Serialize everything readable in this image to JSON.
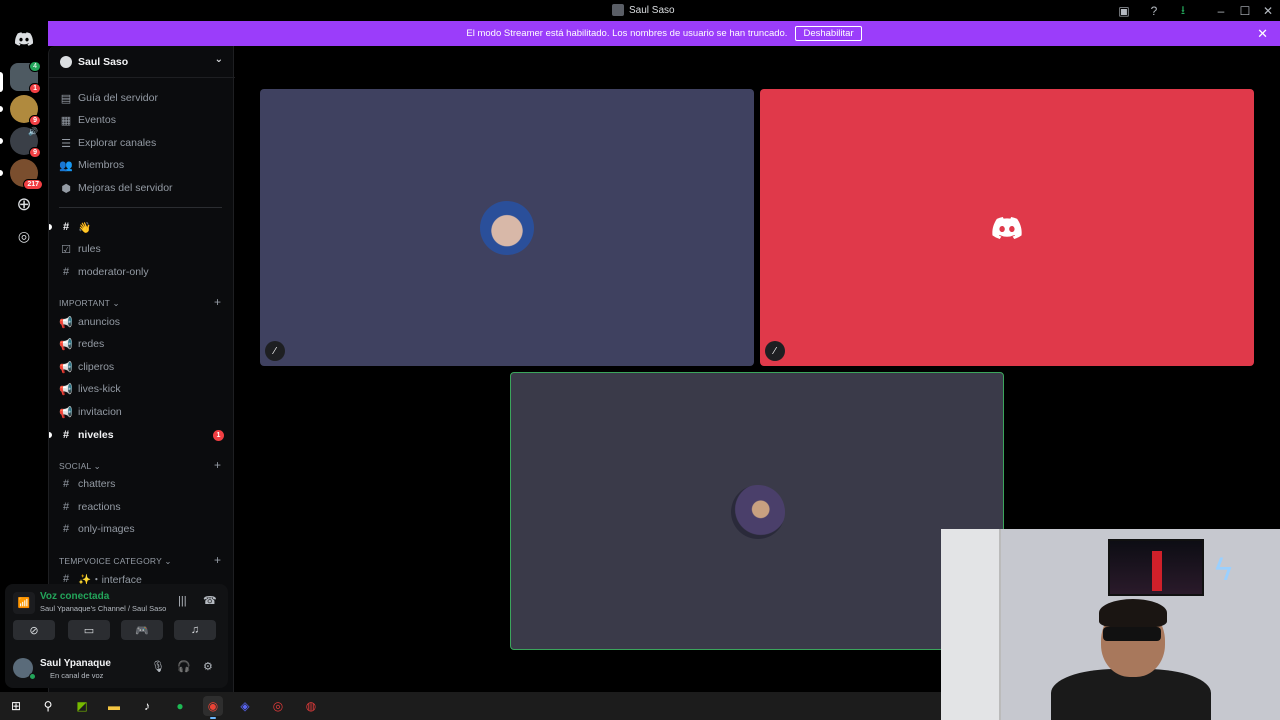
{
  "window": {
    "title": "Saul Saso"
  },
  "banner": {
    "text": "El modo Streamer está habilitado. Los nombres de usuario se han truncado.",
    "button": "Deshabilitar"
  },
  "rail": {
    "servers": [
      {
        "name": "server-1",
        "badge": "1",
        "badge2": "4"
      },
      {
        "name": "server-2",
        "badge": "9"
      },
      {
        "name": "server-3",
        "badge": "9"
      },
      {
        "name": "server-4",
        "badge": "217"
      }
    ]
  },
  "server": {
    "name": "Saul Saso"
  },
  "nav": [
    {
      "label": "Guía del servidor",
      "icon": "guide-icon"
    },
    {
      "label": "Eventos",
      "icon": "calendar-icon"
    },
    {
      "label": "Explorar canales",
      "icon": "channels-icon"
    },
    {
      "label": "Miembros",
      "icon": "members-icon"
    },
    {
      "label": "Mejoras del servidor",
      "icon": "boost-icon"
    }
  ],
  "channels_top": [
    {
      "label": "👋",
      "icon": "hash"
    },
    {
      "label": "rules",
      "icon": "rules"
    },
    {
      "label": "moderator-only",
      "icon": "hash"
    }
  ],
  "categories": {
    "important": "IMPORTANT",
    "social": "SOCIAL",
    "tempvoice": "TEMPVOICE CATEGORY"
  },
  "channels_important": [
    {
      "label": "anuncios",
      "icon": "megaphone"
    },
    {
      "label": "redes",
      "icon": "megaphone"
    },
    {
      "label": "cliperos",
      "icon": "megaphone"
    },
    {
      "label": "lives-kick",
      "icon": "megaphone"
    },
    {
      "label": "invitacion",
      "icon": "megaphone"
    },
    {
      "label": "niveles",
      "icon": "hash",
      "badge": "1"
    }
  ],
  "channels_social": [
    {
      "label": "chatters",
      "icon": "hash"
    },
    {
      "label": "reactions",
      "icon": "hash"
    },
    {
      "label": "only-images",
      "icon": "hash"
    }
  ],
  "channels_tempvoice": [
    {
      "label": "✨・interface",
      "icon": "hash"
    }
  ],
  "voice": {
    "title": "Voz conectada",
    "subtitle": "Saul Ypanaque's Channel / Saul Saso"
  },
  "user": {
    "name": "Saul Ypanaque",
    "status": "En canal de voz"
  },
  "colors": {
    "banner": "#9b3dfa",
    "tile1": "#3f4160",
    "tile2": "#e0394a",
    "tile3": "#3a3a49",
    "speaking": "#3ba55c",
    "online": "#23a55a"
  }
}
